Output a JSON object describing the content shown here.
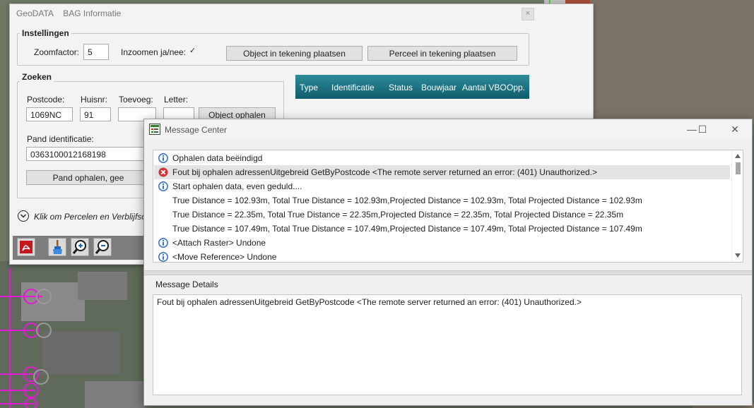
{
  "geodata": {
    "title_app": "GeoDATA",
    "title_sub": "BAG Informatie",
    "close_glyph": "×",
    "instellingen": {
      "legend": "Instellingen",
      "zoomfactor_label": "Zoomfactor:",
      "zoomfactor_value": "5",
      "inzoomen_label": "Inzoomen ja/nee:",
      "inzoomen_checked": "✓",
      "object_button": "Object in tekening plaatsen",
      "perceel_button": "Perceel in tekening plaatsen"
    },
    "zoeken": {
      "legend": "Zoeken",
      "postcode_label": "Postcode:",
      "postcode_value": "1069NC",
      "huisnr_label": "Huisnr:",
      "huisnr_value": "91",
      "toevoeg_label": "Toevoeg:",
      "toevoeg_value": "",
      "letter_label": "Letter:",
      "letter_value": "",
      "object_ophalen_button": "Object ophalen",
      "pand_id_label": "Pand identificatie:",
      "pand_id_value": "0363100012168198",
      "pand_ophalen_button": "Pand ophalen, gee"
    },
    "grid_columns": [
      "Type",
      "Identificatie",
      "Status",
      "Bouwjaar",
      "Aantal VBO",
      "Opp."
    ],
    "expander_text": "Klik om Percelen en Verblijfsol",
    "toolbar_icons": [
      "pdf-icon",
      "brush-icon",
      "zoom-in-icon",
      "zoom-out-icon"
    ]
  },
  "message_center": {
    "title": "Message Center",
    "minimize_glyph": "—",
    "maximize_glyph": "☐",
    "close_glyph": "✕",
    "messages": [
      {
        "type": "info",
        "text": "Ophalen data beëindigd"
      },
      {
        "type": "error",
        "text": "Fout bij ophalen adressenUitgebreid GetByPostcode <The remote server returned an error: (401) Unauthorized.>"
      },
      {
        "type": "info",
        "text": "Start ophalen data, even geduld...."
      },
      {
        "type": "none",
        "text": "True Distance = 102.93m, Total True Distance = 102.93m,Projected Distance = 102.93m, Total Projected Distance = 102.93m"
      },
      {
        "type": "none",
        "text": "True Distance = 22.35m, Total True Distance = 22.35m,Projected Distance = 22.35m, Total Projected Distance = 22.35m"
      },
      {
        "type": "none",
        "text": "True Distance = 107.49m, Total True Distance = 107.49m,Projected Distance = 107.49m, Total Projected Distance = 107.49m"
      },
      {
        "type": "info",
        "text": "<Attach Raster> Undone"
      },
      {
        "type": "info",
        "text": "<Move Reference> Undone"
      }
    ],
    "selected_index": 1,
    "details_label": "Message Details",
    "details_text": "Fout bij ophalen adressenUitgebreid GetByPostcode <The remote server returned an error: (401) Unauthorized.>"
  },
  "colors": {
    "grid_header": "#1b6f7d",
    "error": "#d13438",
    "info": "#1e63c6",
    "map_line_magenta": "#e31bd6",
    "map_line_green": "#33d12a"
  }
}
